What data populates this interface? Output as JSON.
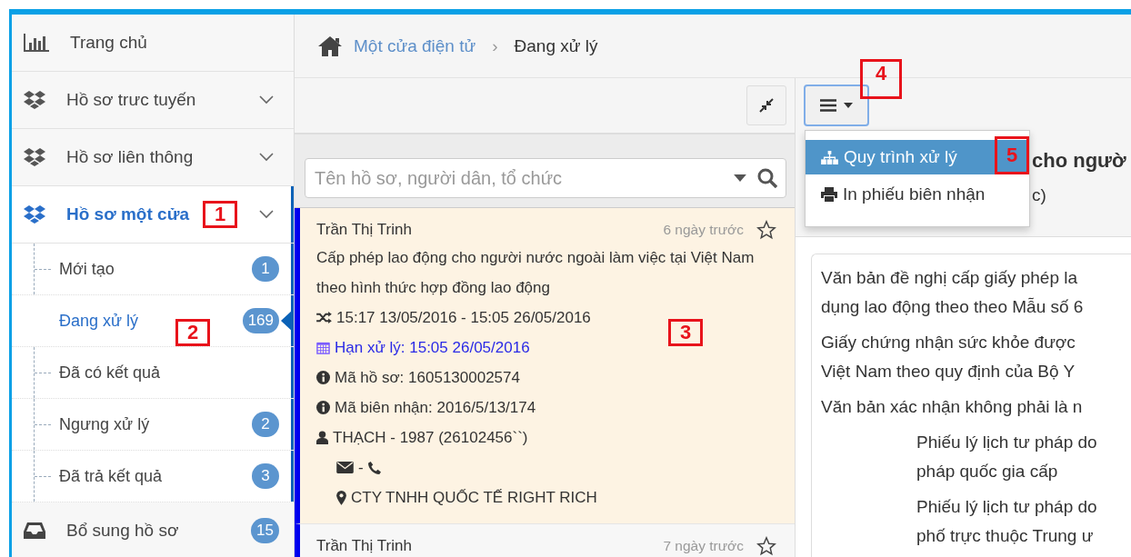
{
  "sidebar": {
    "items": [
      {
        "kind": "chart-link",
        "label": "Trang chủ",
        "selected": false
      },
      {
        "kind": "group",
        "label": "Hồ sơ trưc tuyến",
        "expanded": false,
        "selected": false
      },
      {
        "kind": "group",
        "label": "Hồ sơ liên thông",
        "expanded": false,
        "selected": false
      },
      {
        "kind": "group",
        "label": "Hồ sơ một cửa",
        "expanded": true,
        "selected": true,
        "callout": "1",
        "children": [
          {
            "label": "Mới tạo",
            "badge": "1",
            "selected": false
          },
          {
            "label": "Đang xử lý",
            "badge": "169",
            "selected": true,
            "callout": "2"
          },
          {
            "label": "Đã có kết quả",
            "selected": false
          },
          {
            "label": "Ngưng xử lý",
            "badge": "2",
            "selected": false
          },
          {
            "label": "Đã trả kết quả",
            "badge": "3",
            "selected": false
          }
        ]
      },
      {
        "kind": "inbox-link",
        "label": "Bổ sung hồ sơ",
        "badge": "15",
        "selected": false
      }
    ]
  },
  "breadcrumb": {
    "link": "Một cửa điện tử",
    "separator": "›",
    "current": "Đang xử lý"
  },
  "search": {
    "placeholder": "Tên hồ sơ, người dân, tổ chức"
  },
  "records": [
    {
      "name": "Trần Thị Trinh",
      "time": "6 ngày trước",
      "starred": false,
      "selected": true,
      "callout": "3",
      "title": "Cấp phép lao động cho người nước ngoài làm việc tại Việt Nam theo hình thức hợp đồng lao động",
      "period": "15:17 13/05/2016 - 15:05 26/05/2016",
      "deadline": "Hạn xử lý: 15:05 26/05/2016",
      "file_code": "Mã hồ sơ: 1605130002574",
      "receipt_code": "Mã biên nhận: 2016/5/13/174",
      "person": "THẠCH - 1987 (26102456``)",
      "contact": "-",
      "address": "CTY TNHH QUỐC TẾ RIGHT RICH"
    },
    {
      "name": "Trần Thị Trinh",
      "time": "7 ngày trước",
      "starred": false,
      "selected": false
    }
  ],
  "actions_menu": {
    "open": true,
    "callout": "4",
    "items": [
      {
        "kind": "sitemap",
        "label": "Quy trình xử lý",
        "selected": true,
        "callout": "5"
      },
      {
        "kind": "print",
        "label": "In phiếu biên nhận",
        "selected": false
      }
    ]
  },
  "detail": {
    "title": "cho ngườ",
    "subtitle": "c)",
    "requirements": [
      {
        "indented": false,
        "lines": [
          "Văn bản đề nghị cấp giấy phép la",
          "dụng lao động theo theo Mẫu số 6"
        ]
      },
      {
        "indented": false,
        "lines": [
          "Giấy chứng nhận sức khỏe được",
          "Việt Nam theo quy định của Bộ Y"
        ]
      },
      {
        "indented": false,
        "lines": [
          "Văn bản xác nhận không phải là n"
        ]
      },
      {
        "indented": true,
        "lines": [
          "Phiếu lý lịch tư pháp do",
          "pháp quốc gia cấp"
        ]
      },
      {
        "indented": true,
        "lines": [
          "Phiếu lý lịch tư pháp do",
          "phố trực thuộc Trung ư"
        ]
      }
    ]
  }
}
